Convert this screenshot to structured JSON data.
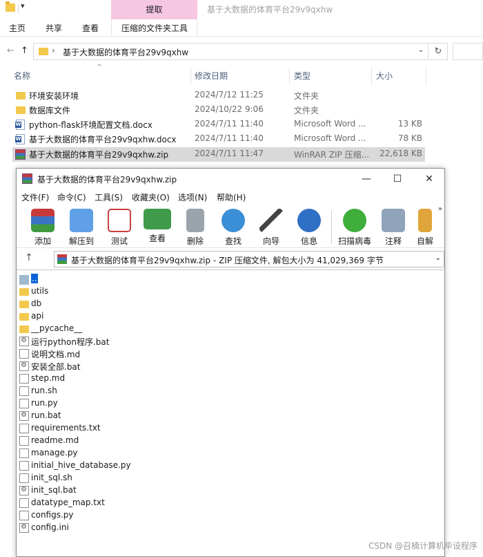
{
  "explorer": {
    "qat_dropdown": "▾",
    "context_tab": "提取",
    "window_title": "基于大数据的体育平台29v9qxhw",
    "ribbon_tabs": [
      "主页",
      "共享",
      "查看",
      "压缩的文件夹工具"
    ],
    "nav": {
      "back": "←",
      "forward": "→",
      "up": "↑",
      "chevron": "›",
      "dropdown": "⌄",
      "refresh": "↻"
    },
    "address_path": "基于大数据的体育平台29v9qxhw",
    "columns": {
      "name": "名称",
      "modified": "修改日期",
      "type": "类型",
      "size": "大小"
    },
    "sort_indicator": "^",
    "files": [
      {
        "name": "环境安装环境",
        "modified": "2024/7/12 11:25",
        "type": "文件夹",
        "size": "",
        "icon": "folder-icon"
      },
      {
        "name": "数据库文件",
        "modified": "2024/10/22 9:06",
        "type": "文件夹",
        "size": "",
        "icon": "folder-icon"
      },
      {
        "name": "python-flask环境配置文档.docx",
        "modified": "2024/7/11 11:40",
        "type": "Microsoft Word ...",
        "size": "13 KB",
        "icon": "word-icon"
      },
      {
        "name": "基于大数据的体育平台29v9qxhw.docx",
        "modified": "2024/7/11 11:40",
        "type": "Microsoft Word ...",
        "size": "78 KB",
        "icon": "word-icon"
      },
      {
        "name": "基于大数据的体育平台29v9qxhw.zip",
        "modified": "2024/7/11 11:47",
        "type": "WinRAR ZIP 压缩...",
        "size": "22,618 KB",
        "icon": "winrar-icon",
        "selected": true
      }
    ]
  },
  "winrar": {
    "title": "基于大数据的体育平台29v9qxhw.zip",
    "controls": {
      "minimize": "—",
      "maximize": "☐",
      "close": "✕"
    },
    "menu": [
      "文件(F)",
      "命令(C)",
      "工具(S)",
      "收藏夹(O)",
      "选项(N)",
      "帮助(H)"
    ],
    "toolbar": [
      "添加",
      "解压到",
      "测试",
      "查看",
      "删除",
      "查找",
      "向导",
      "信息",
      "扫描病毒",
      "注释",
      "自解"
    ],
    "toolbar_more": "»",
    "up_arrow": "↑",
    "path_text": "基于大数据的体育平台29v9qxhw.zip - ZIP 压缩文件, 解包大小为 41,029,369 字节",
    "path_dropdown": "⌄",
    "items": [
      {
        "name": "..",
        "kind": "updir"
      },
      {
        "name": "utils",
        "kind": "folder"
      },
      {
        "name": "db",
        "kind": "folder"
      },
      {
        "name": "api",
        "kind": "folder"
      },
      {
        "name": "__pycache__",
        "kind": "folder"
      },
      {
        "name": "运行python程序.bat",
        "kind": "bat"
      },
      {
        "name": "说明文档.md",
        "kind": "file"
      },
      {
        "name": "安装全部.bat",
        "kind": "bat"
      },
      {
        "name": "step.md",
        "kind": "file"
      },
      {
        "name": "run.sh",
        "kind": "file"
      },
      {
        "name": "run.py",
        "kind": "file"
      },
      {
        "name": "run.bat",
        "kind": "bat"
      },
      {
        "name": "requirements.txt",
        "kind": "file"
      },
      {
        "name": "readme.md",
        "kind": "file"
      },
      {
        "name": "manage.py",
        "kind": "file"
      },
      {
        "name": "initial_hive_database.py",
        "kind": "file"
      },
      {
        "name": "init_sql.sh",
        "kind": "file"
      },
      {
        "name": "init_sql.bat",
        "kind": "bat"
      },
      {
        "name": "datatype_map.txt",
        "kind": "file"
      },
      {
        "name": "configs.py",
        "kind": "file"
      },
      {
        "name": "config.ini",
        "kind": "bat"
      }
    ]
  },
  "watermark": "CSDN @召楠计算机毕设程序"
}
